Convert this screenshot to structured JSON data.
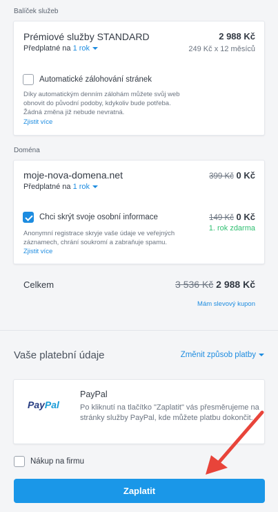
{
  "package": {
    "section_label": "Balíček služeb",
    "title": "Prémiové služby STANDARD",
    "price": "2 988 Kč",
    "subscription_prefix": "Předplatné na",
    "period": "1 rok",
    "price_detail": "249 Kč x 12 měsíců",
    "backup_label": "Automatické zálohování stránek",
    "backup_checked": false,
    "backup_description": "Díky automatickým denním zálohám můžete svůj web obnovit do původní podoby, kdykoliv bude potřeba. Žádná změna již nebude nevratná.",
    "learn_more": "Zjistit více"
  },
  "domain": {
    "section_label": "Doména",
    "name": "moje-nova-domena.net",
    "old_price": "399 Kč",
    "price": "0 Kč",
    "subscription_prefix": "Předplatné na",
    "period": "1 rok",
    "privacy_label": "Chci skrýt svoje osobní informace",
    "privacy_checked": true,
    "privacy_old_price": "149 Kč",
    "privacy_price": "0 Kč",
    "privacy_note": "1. rok zdarma",
    "privacy_description": "Anonymní registrace skryje vaše údaje ve veřejných záznamech, chrání soukromí a zabraňuje spamu.",
    "learn_more": "Zjistit více"
  },
  "total": {
    "label": "Celkem",
    "old_price": "3 536 Kč",
    "price": "2 988 Kč",
    "coupon_link": "Mám slevový kupon"
  },
  "payment": {
    "heading": "Vaše platební údaje",
    "change_method": "Změnit způsob platby",
    "method_name": "PayPal",
    "logo_pay": "Pay",
    "logo_pal": "Pal",
    "description": "Po kliknutí na tlačítko \"Zaplatit\" vás přesměrujeme na stránky služby PayPal, kde můžete platbu dokončit."
  },
  "company": {
    "label": "Nákup na firmu",
    "checked": false
  },
  "submit": {
    "label": "Zaplatit"
  },
  "colors": {
    "accent": "#1d8ce0",
    "button": "#1a97e8",
    "success": "#2fbf71",
    "annotation_arrow": "#e8443a"
  }
}
